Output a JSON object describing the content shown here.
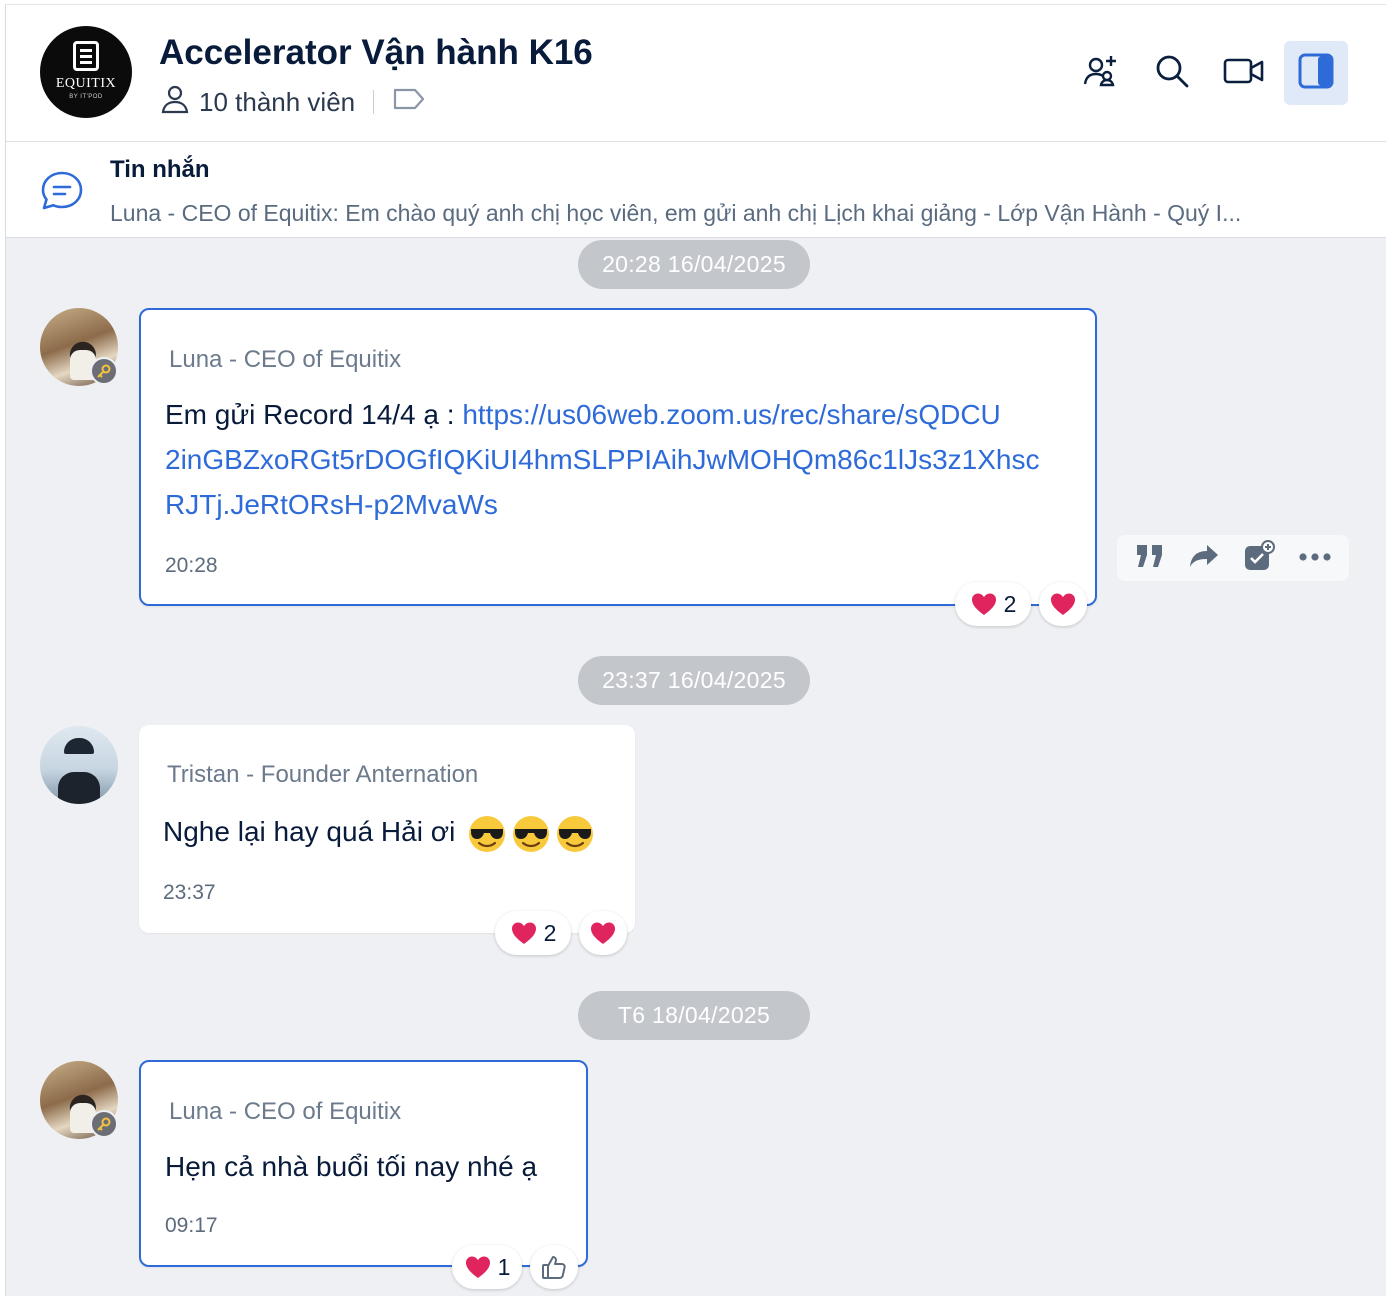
{
  "header": {
    "group_logo_text": "EQUITIX",
    "group_logo_sub": "BY IT'POD",
    "title": "Accelerator Vận hành K16",
    "members_label": "10 thành viên"
  },
  "pinned": {
    "title": "Tin nhắn",
    "preview": "Luna - CEO of Equitix: Em chào quý anh chị học viên, em gửi anh chị  Lịch khai giảng - Lớp Vận Hành - Quý I..."
  },
  "messages": [
    {
      "date": "20:28 16/04/2025",
      "sender": "Luna - CEO of Equitix",
      "text_prefix": "Em gửi Record 14/4 ạ : ",
      "link_lines": [
        "https://us06web.zoom.us/rec/share/sQDCU",
        "2inGBZxoRGt5rDOGfIQKiUI4hmSLPPIAihJwMOHQm86c1lJs3z1Xhsc",
        "RJTj.JeRtORsH-p2MvaWs"
      ],
      "time": "20:28",
      "reaction_count": "2"
    },
    {
      "date": "23:37 16/04/2025",
      "sender": "Tristan - Founder Anternation",
      "text": "Nghe lại hay quá Hải ơi",
      "emojis": [
        "sunglasses-emoji",
        "sunglasses-emoji",
        "sunglasses-emoji"
      ],
      "time": "23:37",
      "reaction_count": "2"
    },
    {
      "date": "T6 18/04/2025",
      "sender": "Luna - CEO of Equitix",
      "text": "Hẹn cả nhà buổi tối nay nhé ạ",
      "time": "09:17",
      "reaction_count": "1"
    }
  ],
  "colors": {
    "accent": "#2e6bd9",
    "background": "#eef0f3",
    "date_pill": "#c3c7cc",
    "heart": "#e0245e"
  },
  "icons": [
    "add-member-icon",
    "search-icon",
    "video-call-icon",
    "sidebar-toggle-icon",
    "user-icon",
    "tag-icon",
    "chat-bubble-icon",
    "quote-icon",
    "forward-icon",
    "add-task-icon",
    "more-icon",
    "key-icon",
    "heart-icon",
    "thumbs-up-icon"
  ]
}
